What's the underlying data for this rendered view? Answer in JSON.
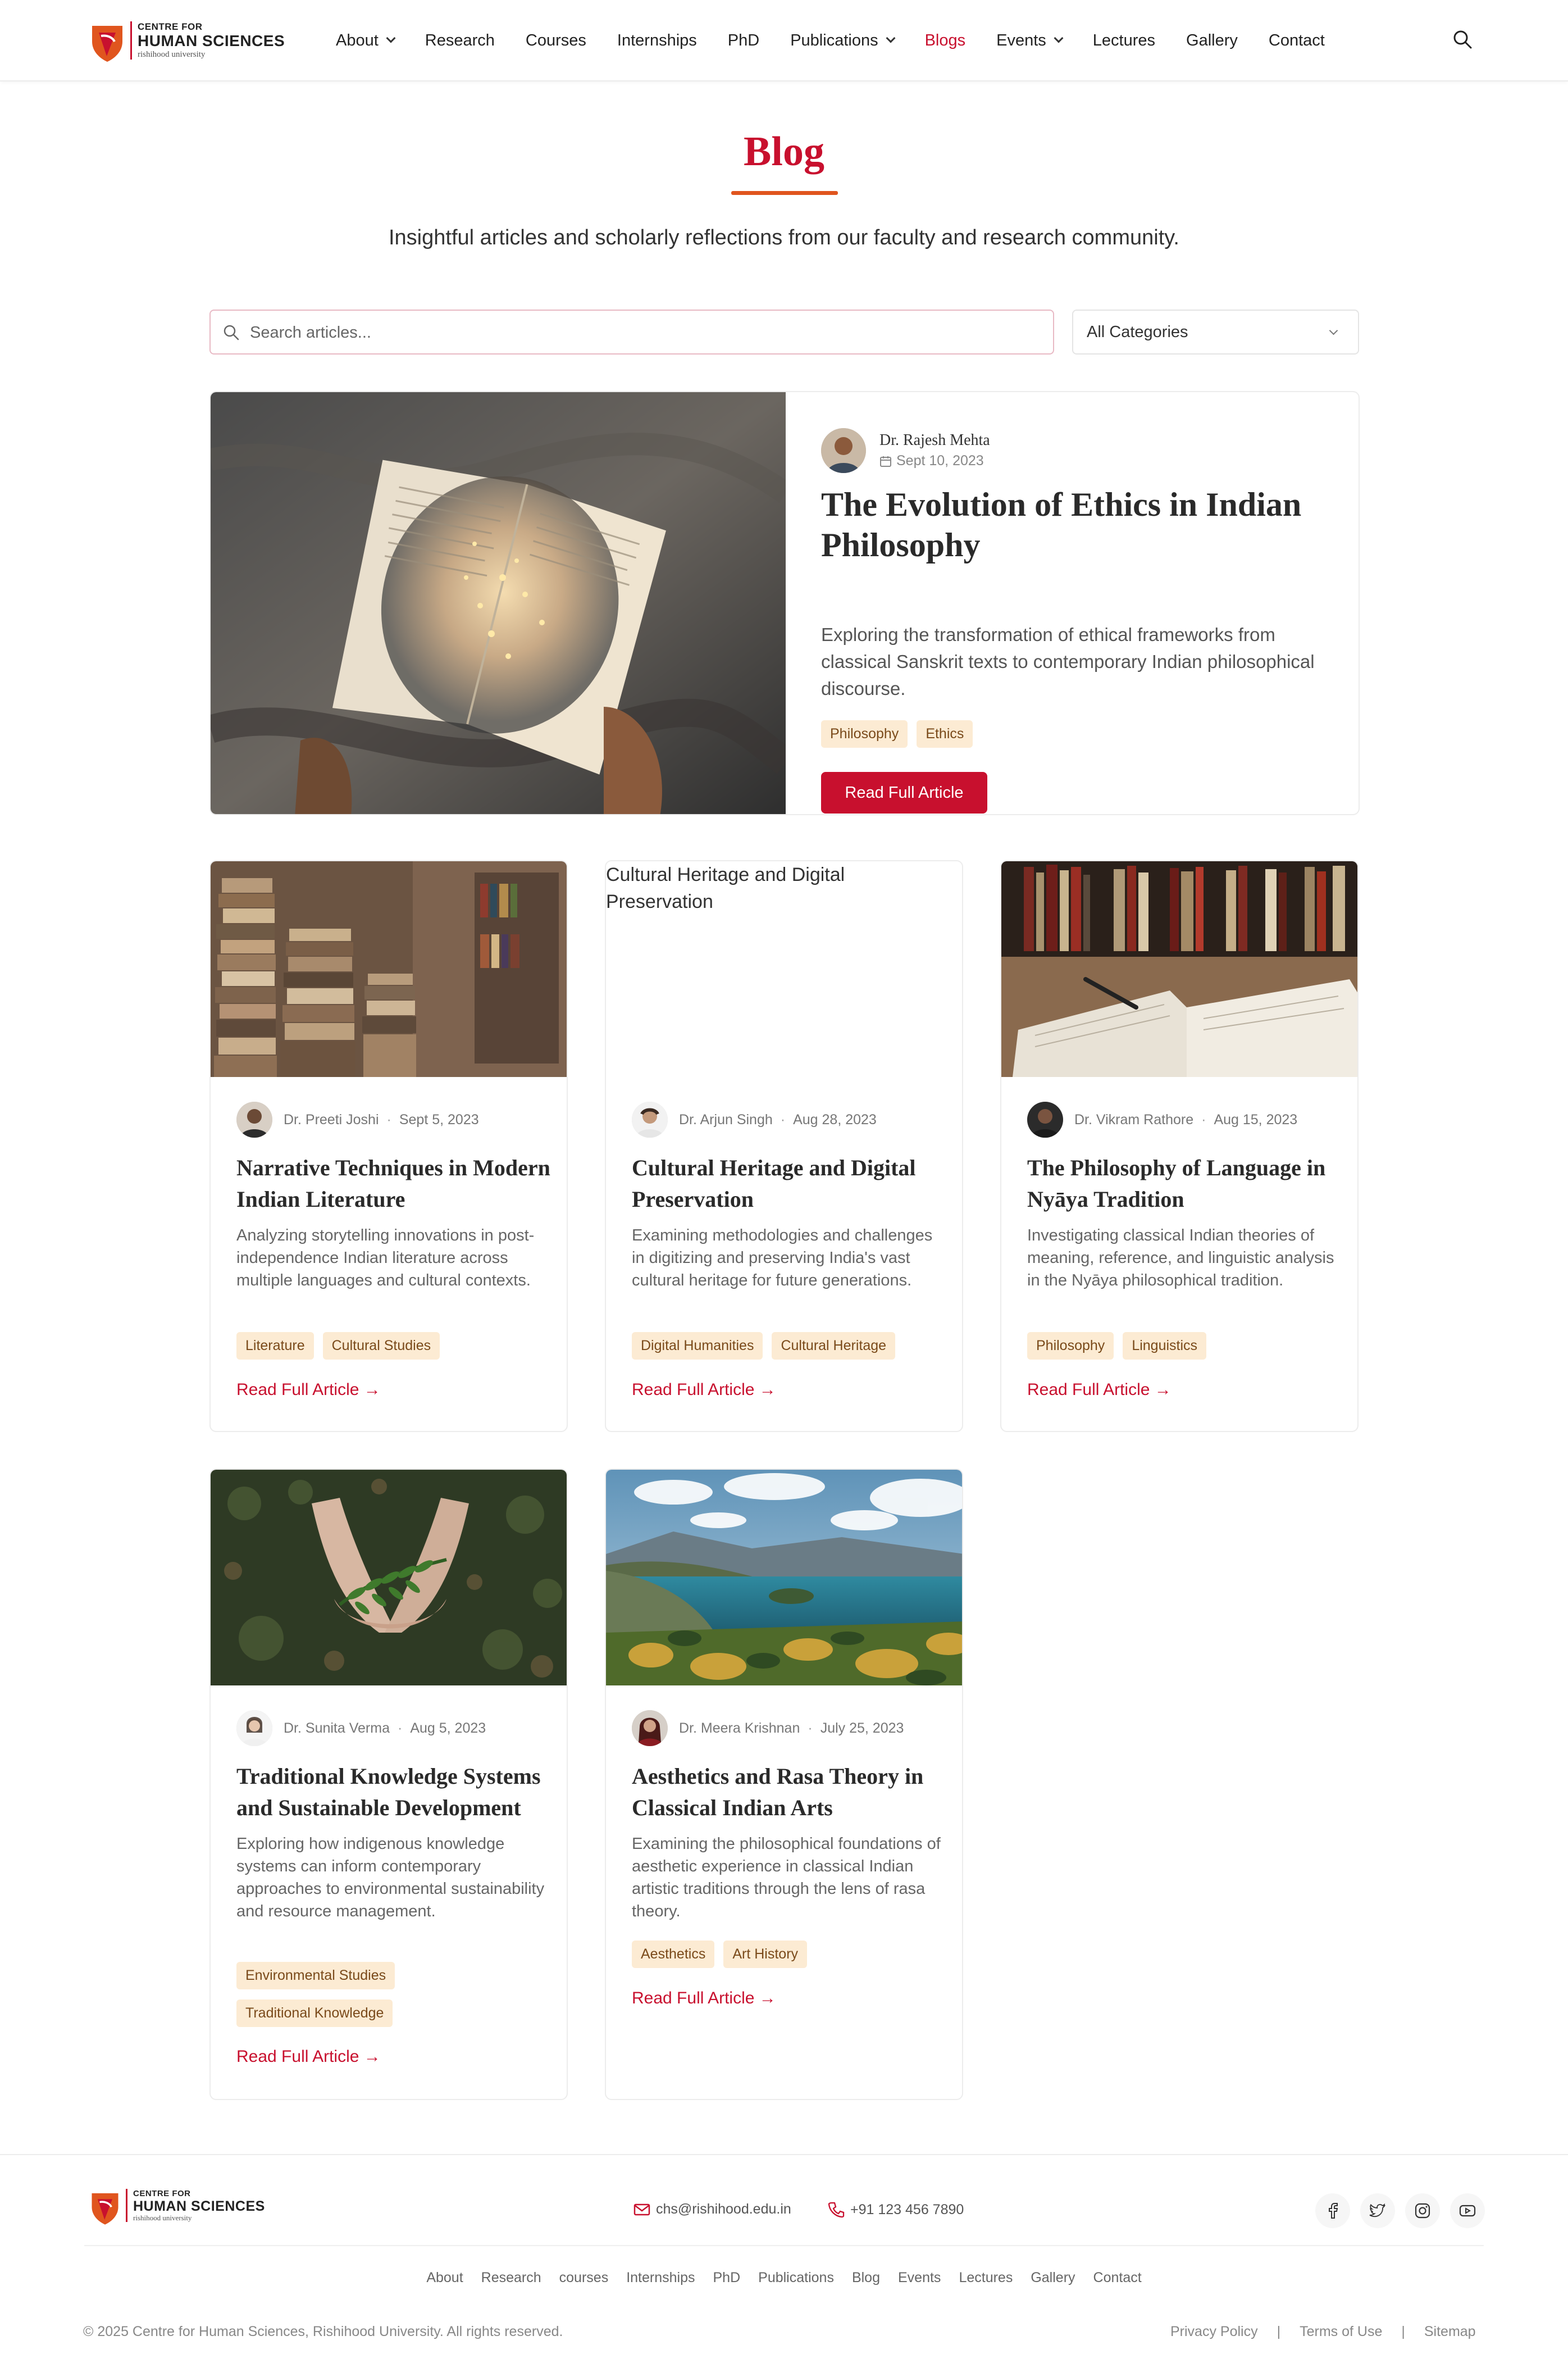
{
  "header": {
    "logo": {
      "line1": "CENTRE FOR",
      "line2": "HUMAN SCIENCES",
      "line3": "rishihood university"
    },
    "nav": [
      {
        "label": "About",
        "dropdown": true
      },
      {
        "label": "Research"
      },
      {
        "label": "Courses"
      },
      {
        "label": "Internships"
      },
      {
        "label": "PhD"
      },
      {
        "label": "Publications",
        "dropdown": true
      },
      {
        "label": "Blogs",
        "active": true
      },
      {
        "label": "Events",
        "dropdown": true
      },
      {
        "label": "Lectures"
      },
      {
        "label": "Gallery"
      },
      {
        "label": "Contact"
      }
    ],
    "search_icon": "search-icon"
  },
  "hero": {
    "title": "Blog",
    "subtitle": "Insightful articles and scholarly reflections from our faculty and research community."
  },
  "filters": {
    "search_placeholder": "Search articles...",
    "category_selected": "All Categories"
  },
  "featured": {
    "author": "Dr. Rajesh Mehta",
    "date": "Sept 10, 2023",
    "title": "The Evolution of Ethics in Indian Philosophy",
    "excerpt": "Exploring the transformation of ethical frameworks from classical Sanskrit texts to contemporary Indian philosophical discourse.",
    "tags": [
      "Philosophy",
      "Ethics"
    ],
    "button": "Read Full Article"
  },
  "posts": [
    {
      "author": "Dr. Preeti Joshi",
      "date": "Sept 5, 2023",
      "title": "Narrative Techniques in Modern Indian Literature",
      "excerpt": "Analyzing storytelling innovations in post-independence Indian literature across multiple languages and cultural contexts.",
      "tags": [
        "Literature",
        "Cultural Studies"
      ],
      "link": "Read Full Article →"
    },
    {
      "author": "Dr. Arjun Singh",
      "date": "Aug 28, 2023",
      "title": "Cultural Heritage and Digital Preservation",
      "excerpt": "Examining methodologies and challenges in digitizing and preserving India's vast cultural heritage for future generations.",
      "tags": [
        "Digital Humanities",
        "Cultural Heritage"
      ],
      "link": "Read Full Article →",
      "image_alt": "Cultural Heritage and Digital Preservation"
    },
    {
      "author": "Dr. Vikram Rathore",
      "date": "Aug 15, 2023",
      "title": "The Philosophy of Language in Nyāya Tradition",
      "excerpt": "Investigating classical Indian theories of meaning, reference, and linguistic analysis in the Nyāya philosophical tradition.",
      "tags": [
        "Philosophy",
        "Linguistics"
      ],
      "link": "Read Full Article →"
    },
    {
      "author": "Dr. Sunita Verma",
      "date": "Aug 5, 2023",
      "title": "Traditional Knowledge Systems and Sustainable Development",
      "excerpt": "Exploring how indigenous knowledge systems can inform contemporary approaches to environmental sustainability and resource management.",
      "tags": [
        "Environmental Studies",
        "Traditional Knowledge"
      ],
      "link": "Read Full Article →"
    },
    {
      "author": "Dr. Meera Krishnan",
      "date": "July 25, 2023",
      "title": "Aesthetics and Rasa Theory in Classical Indian Arts",
      "excerpt": "Examining the philosophical foundations of aesthetic experience in classical Indian artistic traditions through the lens of rasa theory.",
      "tags": [
        "Aesthetics",
        "Art History"
      ],
      "link": "Read Full Article →"
    }
  ],
  "footer": {
    "logo": {
      "line1": "CENTRE FOR",
      "line2": "HUMAN SCIENCES",
      "line3": "rishihood university"
    },
    "email": "chs@rishihood.edu.in",
    "phone": "+91 123 456 7890",
    "social_icons": [
      "facebook-icon",
      "twitter-icon",
      "instagram-icon",
      "youtube-icon"
    ],
    "links": [
      "About",
      "Research",
      "courses",
      "Internships",
      "PhD",
      "Publications",
      "Blog",
      "Events",
      "Lectures",
      "Gallery",
      "Contact"
    ],
    "copyright": "© 2025 Centre for Human Sciences, Rishihood University. All rights reserved.",
    "legal": [
      "Privacy Policy",
      "Terms of Use",
      "Sitemap"
    ]
  },
  "colors": {
    "accent": "#c8102e",
    "underline": "#e0551e",
    "tag_bg": "#fcebd3",
    "tag_text": "#7a4a1a"
  }
}
